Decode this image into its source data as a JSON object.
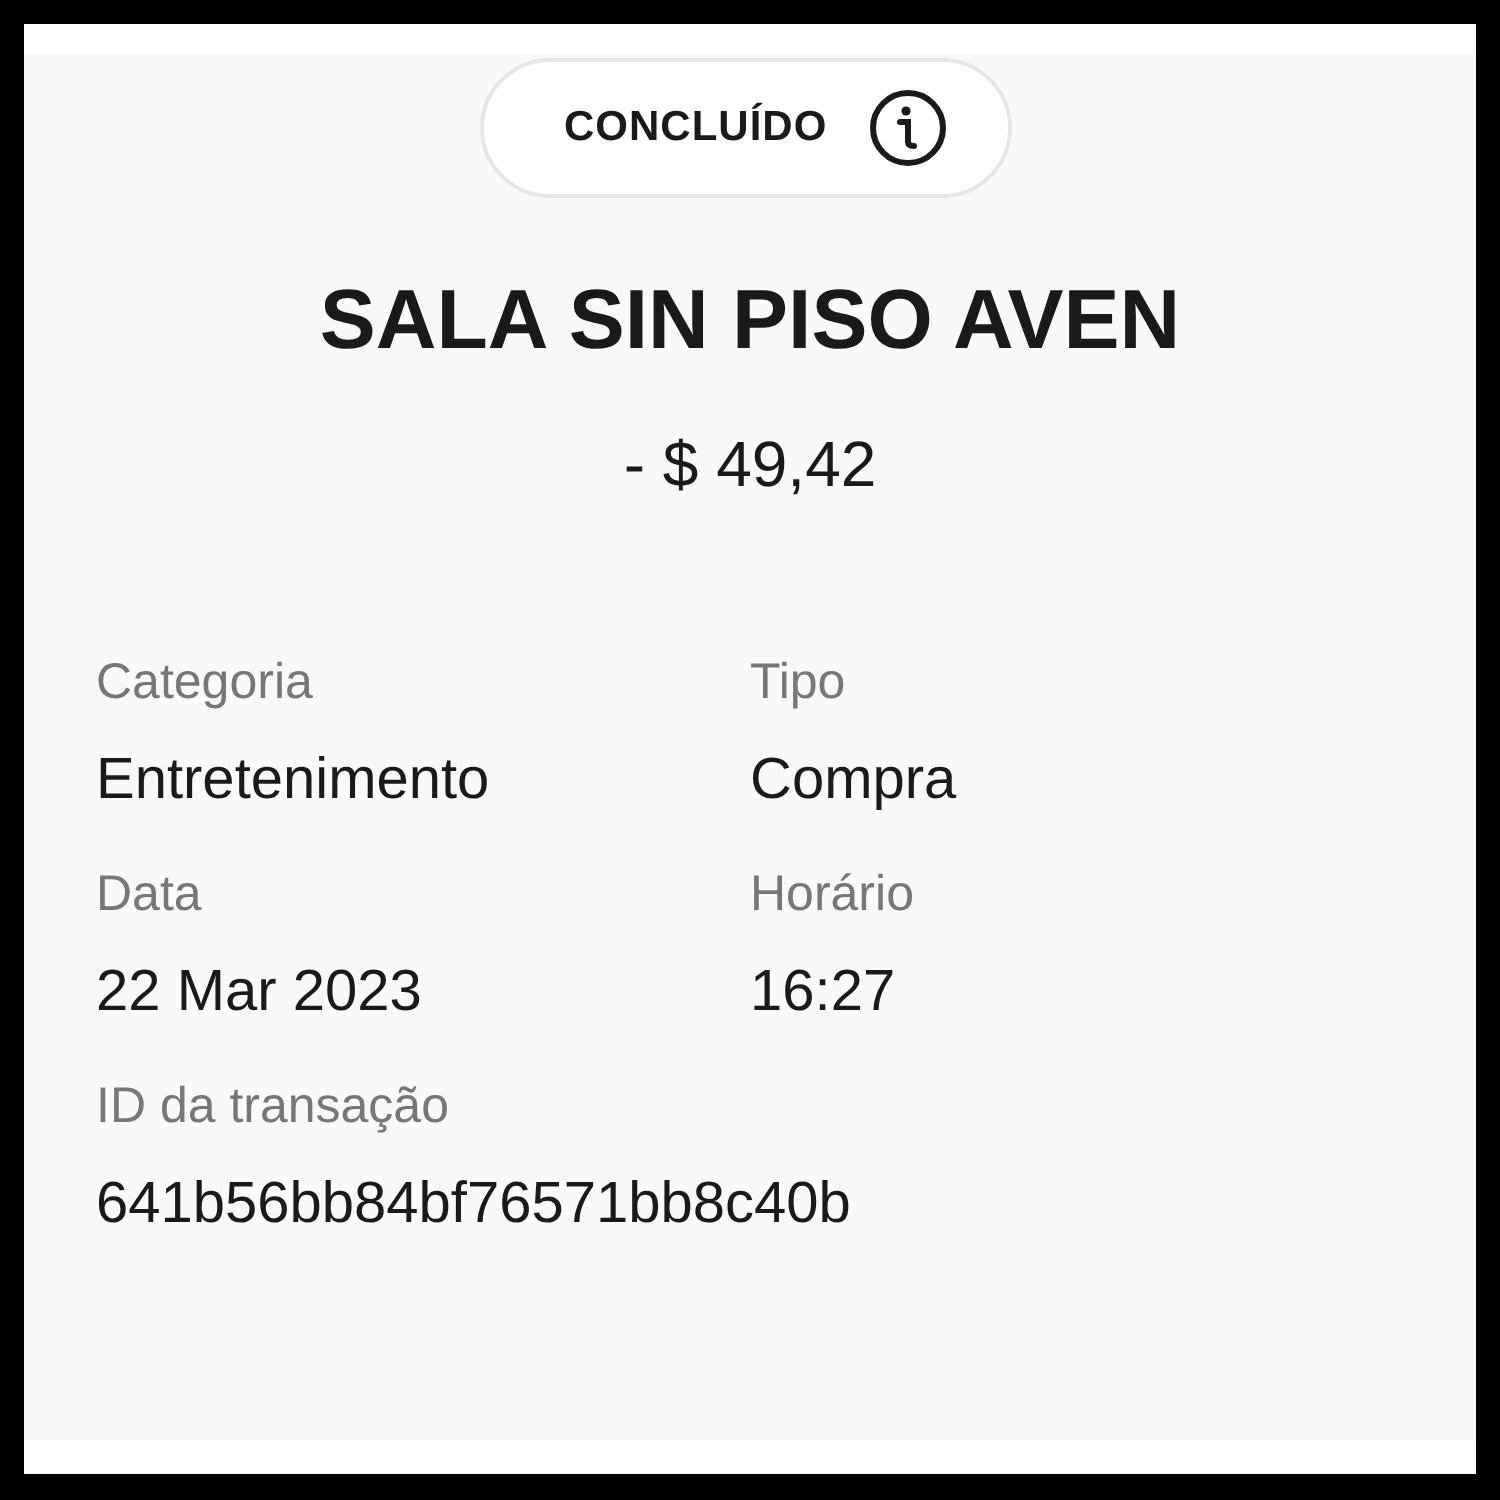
{
  "status": {
    "label": "CONCLUÍDO"
  },
  "title": "SALA SIN PISO AVEN",
  "amount": "- $ 49,42",
  "details": [
    {
      "label": "Categoria",
      "value": "Entretenimento"
    },
    {
      "label": "Tipo",
      "value": "Compra"
    },
    {
      "label": "Data",
      "value": "22 Mar 2023"
    },
    {
      "label": "Horário",
      "value": "16:27"
    },
    {
      "label": "ID da transação",
      "value": "641b56bb84bf76571bb8c40b"
    }
  ]
}
